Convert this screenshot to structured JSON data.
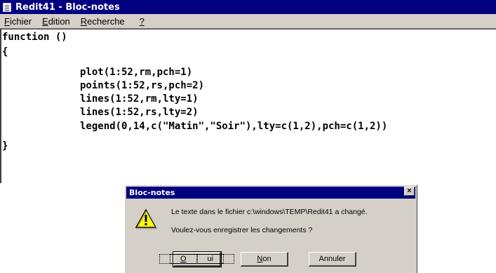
{
  "notepad": {
    "title": "Redit41 - Bloc-notes",
    "menu": [
      {
        "label": "Fichier",
        "mnemonic": "F",
        "rest": "ichier"
      },
      {
        "label": "Edition",
        "mnemonic": "E",
        "rest": "dition"
      },
      {
        "label": "Recherche",
        "mnemonic": "R",
        "rest": "echerche"
      },
      {
        "label": "?",
        "mnemonic": "?",
        "rest": ""
      }
    ],
    "code_lines": [
      "function ()",
      "{",
      "plot(1:52,rm,pch=1)",
      "points(1:52,rs,pch=2)",
      "lines(1:52,rm,lty=1)",
      "lines(1:52,rs,lty=2)",
      "legend(0,14,c(\"Matin\",\"Soir\"),lty=c(1,2),pch=c(1,2))",
      "}"
    ]
  },
  "dialog": {
    "title": "Bloc-notes",
    "close_glyph": "×",
    "message_line1": "Le texte dans le fichier c:\\windows\\TEMP\\Redit41 a changé.",
    "message_line2": "Voulez-vous enregistrer les changements ?",
    "buttons": {
      "yes": {
        "mnemonic": "O",
        "rest": "ui"
      },
      "no": {
        "mnemonic": "N",
        "rest": "on"
      },
      "cancel": {
        "label": "Annuler"
      }
    },
    "icon": "warning-icon"
  },
  "colors": {
    "titlebar": "#000080",
    "chrome": "#d4d0c8",
    "warning_fill": "#ffff00"
  }
}
